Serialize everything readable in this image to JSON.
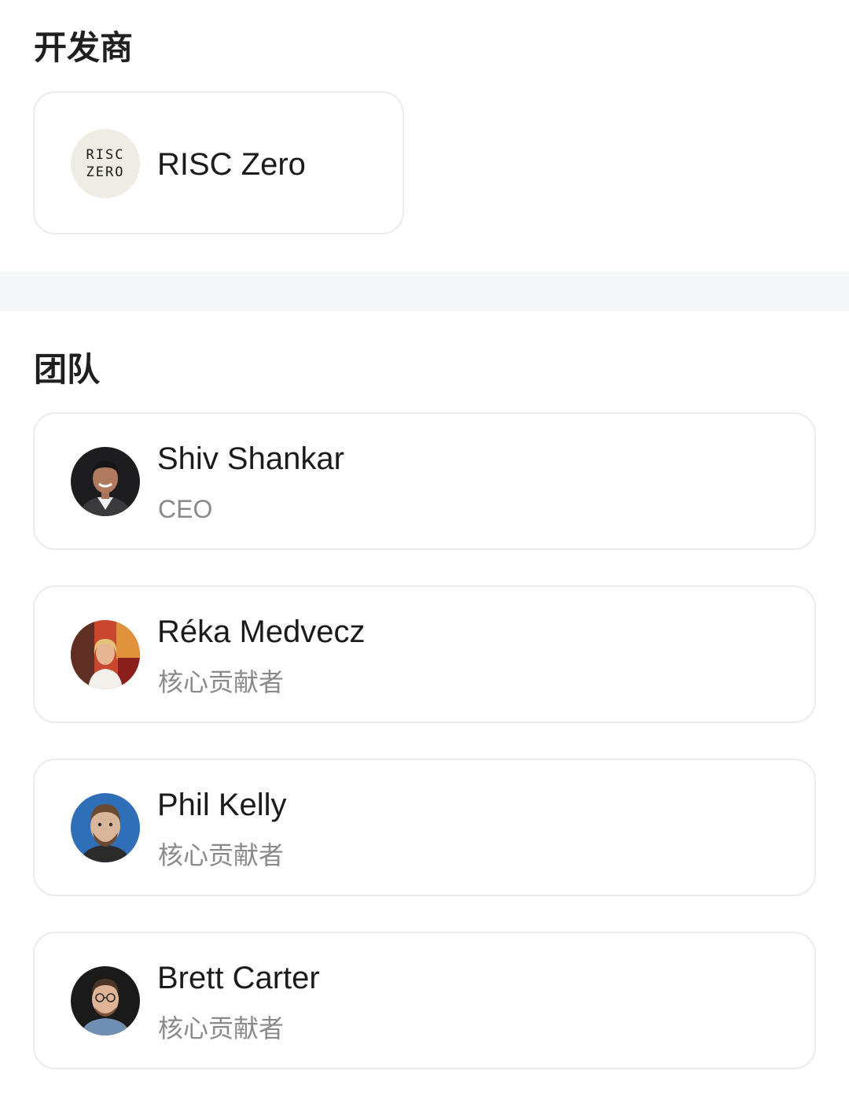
{
  "developer_section": {
    "title": "开发商",
    "developer": {
      "logo_text_line1": "RISC",
      "logo_text_line2": "ZERO",
      "name": "RISC Zero"
    }
  },
  "team_section": {
    "title": "团队",
    "members": [
      {
        "name": "Shiv Shankar",
        "role": "CEO",
        "avatar_icon": "avatar-photo"
      },
      {
        "name": "Réka Medvecz",
        "role": "核心贡献者",
        "avatar_icon": "avatar-photo"
      },
      {
        "name": "Phil Kelly",
        "role": "核心贡献者",
        "avatar_icon": "avatar-photo"
      },
      {
        "name": "Brett Carter",
        "role": "核心贡献者",
        "avatar_icon": "avatar-photo"
      }
    ]
  },
  "colors": {
    "card_border": "#ebebeb",
    "divider_band": "#f6f7f8",
    "role_text": "#8a8a8a",
    "logo_bg": "#efece4"
  }
}
